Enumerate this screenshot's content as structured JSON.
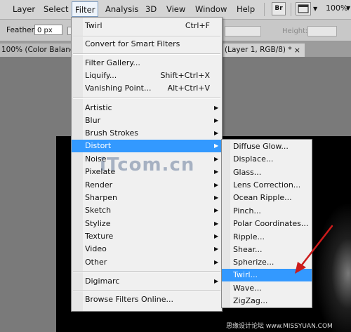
{
  "menubar": {
    "items": [
      "Layer",
      "Select",
      "Filter",
      "Analysis",
      "3D",
      "View",
      "Window",
      "Help"
    ],
    "br_icon": "Br",
    "zoom": "100%"
  },
  "options": {
    "feather_label": "Feather:",
    "feather_value": "0 px",
    "height_label": "Height:"
  },
  "tabs": {
    "tab1": "100% (Color Balance",
    "tab2": "(Layer 1, RGB/8) *",
    "close_glyph": "×"
  },
  "filter_menu": {
    "items": [
      {
        "label": "Twirl",
        "shortcut": "Ctrl+F"
      },
      {
        "label": "Convert for Smart Filters"
      },
      {
        "label": "Filter Gallery..."
      },
      {
        "label": "Liquify...",
        "shortcut": "Shift+Ctrl+X"
      },
      {
        "label": "Vanishing Point...",
        "shortcut": "Alt+Ctrl+V"
      },
      {
        "label": "Artistic"
      },
      {
        "label": "Blur"
      },
      {
        "label": "Brush Strokes"
      },
      {
        "label": "Distort"
      },
      {
        "label": "Noise"
      },
      {
        "label": "Pixelate"
      },
      {
        "label": "Render"
      },
      {
        "label": "Sharpen"
      },
      {
        "label": "Sketch"
      },
      {
        "label": "Stylize"
      },
      {
        "label": "Texture"
      },
      {
        "label": "Video"
      },
      {
        "label": "Other"
      },
      {
        "label": "Digimarc"
      },
      {
        "label": "Browse Filters Online..."
      }
    ]
  },
  "distort_menu": {
    "items": [
      "Diffuse Glow...",
      "Displace...",
      "Glass...",
      "Lens Correction...",
      "Ocean Ripple...",
      "Pinch...",
      "Polar Coordinates...",
      "Ripple...",
      "Shear...",
      "Spherize...",
      "Twirl...",
      "Wave...",
      "ZigZag..."
    ]
  },
  "watermark": {
    "logo": "iTcom.cn",
    "footer": "思缘设计论坛 www.MISSYUAN.COM"
  },
  "colors": {
    "highlight": "#3399ff",
    "arrow": "#cc1b1b"
  }
}
